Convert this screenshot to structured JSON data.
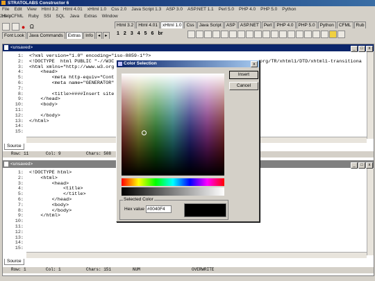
{
  "app": {
    "title": "STRATOLABS Constructor 6"
  },
  "menu": [
    "File",
    "Edit",
    "View",
    "Html 3.2",
    "Html 4.01",
    "xHtml 1.0",
    "Css 2.0",
    "Java Script 1.3",
    "ASP 3.0",
    "ASP.NET 1.1",
    "Perl 5.0",
    "PHP 4.0",
    "PHP 5.0",
    "Python 2.0",
    "CFML",
    "Ruby",
    "SSI",
    "SQL",
    "Java",
    "Extras",
    "Window"
  ],
  "help_menu": "Help",
  "left_tabs": {
    "font_look": "Font Look",
    "java_commands": "Java Commands",
    "extras": "Extras",
    "info": "Info"
  },
  "lang_tabs": [
    "Html 3.2",
    "Html 4.01",
    "xHtml 1.0",
    "Css",
    "Java Script",
    "ASP",
    "ASP.NET",
    "Perl",
    "PHP 4.0",
    "PHP 5.0",
    "Python",
    "CFML",
    "Rub"
  ],
  "heading_buttons": [
    "1",
    "2",
    "3",
    "4",
    "5",
    "6",
    "br"
  ],
  "top_window": {
    "title": "<unsaved>",
    "line_numbers": [
      "1:",
      "2:",
      "3:",
      "4:",
      "5:",
      "6:",
      "7:",
      "8:",
      "9:",
      "10:",
      "11:",
      "12:",
      "13:",
      "14:",
      "15:"
    ],
    "lines": [
      "<?xml version=\"1.0\" encoding=\"iso-8859-1\"?>",
      "<!DOCTYPE  html PUBLIC \"-//W3C",
      "<html xmlns=\"http://www.w3.org",
      "    <head>",
      "        <meta http-equiv=\"Cont",
      "        <meta name=\"GENERATOR\"",
      "",
      "        <title>####Insert site",
      "    </head>",
      "    <body>",
      "",
      "    </body>",
      "</html>",
      "",
      ""
    ],
    "right_fragment": "org/TR/xhtml1/DTD/xhtml1-transitiona",
    "source_tab": "Source",
    "status": {
      "row": "Row:  11",
      "col": "Col:  9",
      "chars": "Chars:  508"
    }
  },
  "bottom_window": {
    "title": "<unsaved>",
    "line_numbers": [
      "1:",
      "2:",
      "3:",
      "4:",
      "5:",
      "6:",
      "7:",
      "8:",
      "9:",
      "10:",
      "11:",
      "12:",
      "13:",
      "14:",
      "15:"
    ],
    "lines": [
      "<!DOCTYPE html>",
      "    <html>",
      "        <head>",
      "            <title>",
      "            </title>",
      "        </head>",
      "        <body>",
      "        </body>",
      "    </html>",
      "",
      "",
      "",
      "",
      "",
      ""
    ],
    "source_tab": "Source",
    "status": {
      "row": "Row:  1",
      "col": "Col:  1",
      "chars": "Chars:  151",
      "num": "NUM",
      "mode": "OVERWRITE"
    }
  },
  "dialog": {
    "title": "Color Selection",
    "insert_label": "Insert",
    "cancel_label": "Cancel",
    "group_label": "Selected Color",
    "hex_label": "Hex value",
    "hex_value": "#0040F4",
    "preview_color": "#000000",
    "close_glyph": "x"
  },
  "colors": {
    "accent": "#0a246a",
    "face": "#d4d0c8"
  }
}
